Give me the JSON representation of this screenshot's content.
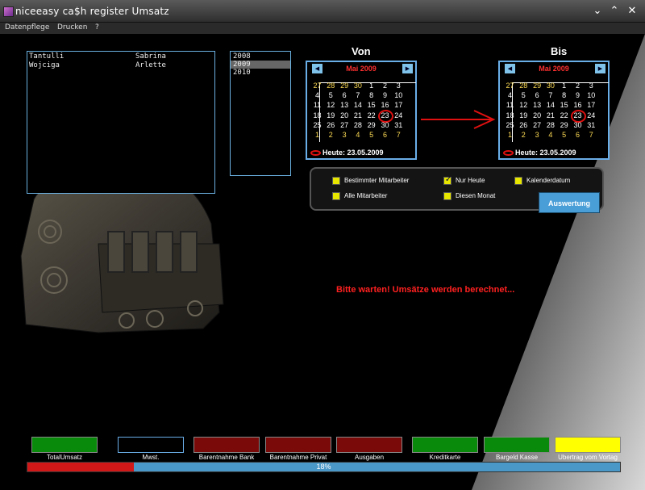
{
  "window": {
    "title": "niceeasy ca$h register  Umsatz"
  },
  "menu": {
    "items": [
      "Datenpflege",
      "Drucken",
      "?"
    ]
  },
  "employees": [
    {
      "last": "Tantulli",
      "first": "Sabrina"
    },
    {
      "last": "Wojciga",
      "first": "Arlette"
    }
  ],
  "years": {
    "items": [
      "2008",
      "2009",
      "2010"
    ],
    "selected": "2009"
  },
  "von": {
    "heading": "Von",
    "month": "Mai 2009",
    "today_label": "Heute: 23.05.2009",
    "weeks": [
      [
        "27",
        "28",
        "29",
        "30",
        "1",
        "2",
        "3"
      ],
      [
        "4",
        "5",
        "6",
        "7",
        "8",
        "9",
        "10"
      ],
      [
        "11",
        "12",
        "13",
        "14",
        "15",
        "16",
        "17"
      ],
      [
        "18",
        "19",
        "20",
        "21",
        "22",
        "23",
        "24"
      ],
      [
        "25",
        "26",
        "27",
        "28",
        "29",
        "30",
        "31"
      ],
      [
        "1",
        "2",
        "3",
        "4",
        "5",
        "6",
        "7"
      ]
    ],
    "today_day": "23"
  },
  "bis": {
    "heading": "Bis",
    "month": "Mai 2009",
    "today_label": "Heute: 23.05.2009",
    "weeks": [
      [
        "27",
        "28",
        "29",
        "30",
        "1",
        "2",
        "3"
      ],
      [
        "4",
        "5",
        "6",
        "7",
        "8",
        "9",
        "10"
      ],
      [
        "11",
        "12",
        "13",
        "14",
        "15",
        "16",
        "17"
      ],
      [
        "18",
        "19",
        "20",
        "21",
        "22",
        "23",
        "24"
      ],
      [
        "25",
        "26",
        "27",
        "28",
        "29",
        "30",
        "31"
      ],
      [
        "1",
        "2",
        "3",
        "4",
        "5",
        "6",
        "7"
      ]
    ],
    "today_day": "23"
  },
  "options": {
    "bestimmter": {
      "label": "Bestimmter Mitarbeiter",
      "checked": false
    },
    "alle": {
      "label": "Alle Mitarbeiter",
      "checked": false
    },
    "nur_heute": {
      "label": "Nur Heute",
      "checked": true
    },
    "diesen_monat": {
      "label": "Diesen Monat",
      "checked": false
    },
    "kalenderdatum": {
      "label": "Kalenderdatum",
      "checked": false
    }
  },
  "auswertung_label": "Auswertung",
  "status_text": "Bitte warten!  Umsätze werden berechnet...",
  "summary": [
    {
      "label": "TotalUmsatz",
      "color": "#0a8a0a"
    },
    {
      "label": "Mwst.",
      "color": "#000000"
    },
    {
      "label": "Barentnahme Bank",
      "color": "#7a0a0a"
    },
    {
      "label": "Barentnahme Privat",
      "color": "#7a0a0a"
    },
    {
      "label": "Ausgaben",
      "color": "#7a0a0a"
    },
    {
      "label": "Kreditkarte",
      "color": "#0a8a0a"
    },
    {
      "label": "Bargeld Kasse",
      "color": "#0a8a0a"
    },
    {
      "label": "Ubertrag vom Vortag",
      "color": "#ffff00"
    }
  ],
  "progress": {
    "value": 0.18,
    "label": "18%"
  },
  "colors": {
    "accent": "#6aaee8",
    "warning": "#ff2020",
    "bg": "#000000"
  }
}
